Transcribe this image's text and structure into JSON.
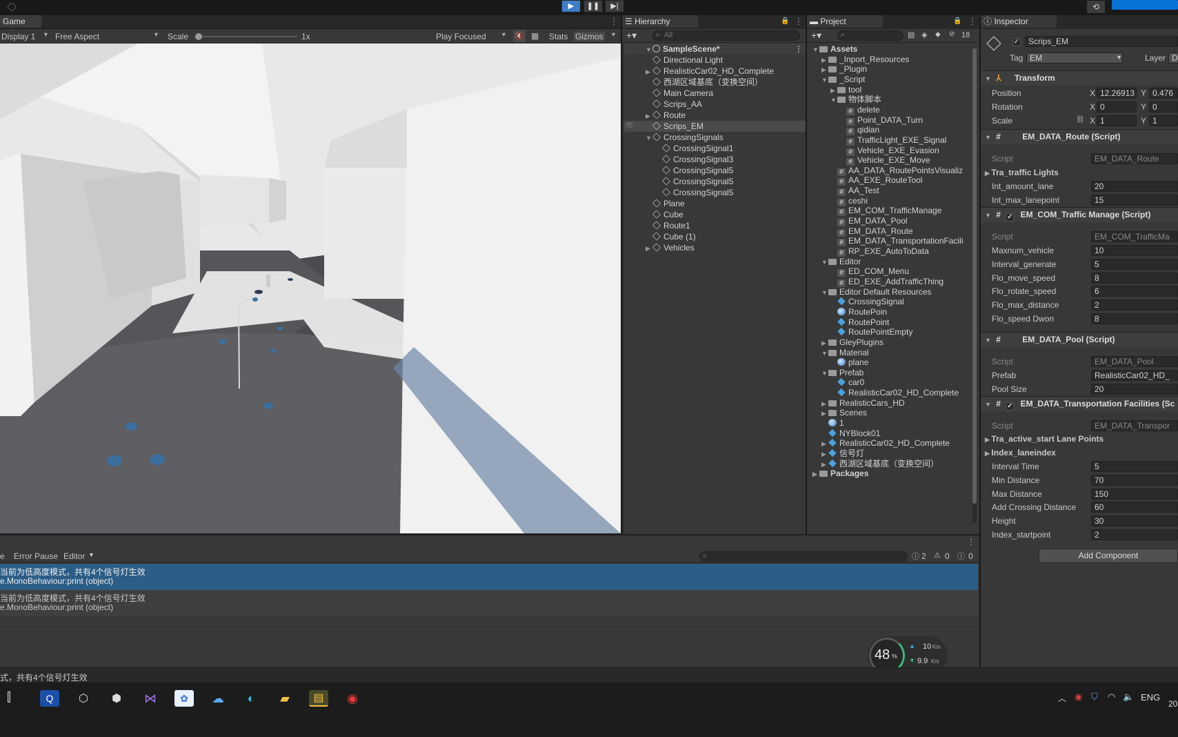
{
  "game": {
    "tab": "Game",
    "display": "Display 1",
    "aspect": "Free Aspect",
    "scale_label": "Scale",
    "scale_value": "1x",
    "play_mode": "Play Focused",
    "stats": "Stats",
    "gizmos": "Gizmos"
  },
  "hierarchy": {
    "tab": "Hierarchy",
    "search_placeholder": "All",
    "scene": "SampleScene*",
    "items": [
      "Directional Light",
      "RealisticCar02_HD_Complete",
      "西湖区域基底（变换空间）",
      "Main Camera",
      "Scrips_AA",
      "Route",
      "Scrips_EM",
      "CrossingSignals",
      "CrossingSignal1",
      "CrossingSignal3",
      "CrossingSignal5",
      "CrossingSignal5",
      "CrossingSignal5",
      "Plane",
      "Cube",
      "Route1",
      "Cube (1)",
      "Vehicles"
    ]
  },
  "project": {
    "tab": "Project",
    "badge": "18",
    "items": [
      "Assets",
      "_Inport_Resources",
      "_Plugin",
      "_Script",
      "tool",
      "物体脚本",
      "delete",
      "Point_DATA_Turn",
      "qidian",
      "TrafficLight_EXE_Signal",
      "Vehicle_EXE_Evasion",
      "Vehicle_EXE_Move",
      "AA_DATA_RoutePointsVisualiz",
      "AA_EXE_RouteTool",
      "AA_Test",
      "ceshi",
      "EM_COM_TrafficManage",
      "EM_DATA_Pool",
      "EM_DATA_Route",
      "EM_DATA_TransportationFacili",
      "RP_EXE_AutoToData",
      "Editor",
      "ED_COM_Menu",
      "ED_EXE_AddTrafficThing",
      "Editor Default Resources",
      "CrossingSignal",
      "RoutePoin",
      "RoutePoint",
      "RoutePointEmpty",
      "GleyPlugins",
      "Material",
      "plane",
      "Prefab",
      "car0",
      "RealisticCar02_HD_Complete",
      "RealisticCars_HD",
      "Scenes",
      "1",
      "NYBlock01",
      "RealisticCar02_HD_Complete",
      "信号灯",
      "西湖区域基底（变换空间）",
      "Packages"
    ]
  },
  "inspector": {
    "tab": "Inspector",
    "object_name": "Scrips_EM",
    "tag_label": "Tag",
    "tag_value": "EM",
    "layer_label": "Layer",
    "layer_value": "Defa",
    "transform": {
      "title": "Transform",
      "position_label": "Position",
      "position_x": "12.26913",
      "position_y": "0.476",
      "rotation_label": "Rotation",
      "rotation_x": "0",
      "rotation_y": "0",
      "scale_label": "Scale",
      "scale_x": "1",
      "scale_y": "1",
      "x": "X",
      "y": "Y"
    },
    "route": {
      "title": "EM_DATA_Route (Script)",
      "script_label": "Script",
      "script_value": "EM_DATA_Route",
      "lights": "Tra_traffic Lights",
      "amount_label": "Int_amount_lane",
      "amount_value": "20",
      "max_label": "Int_max_lanepoint",
      "max_value": "15"
    },
    "traffic": {
      "title": "EM_COM_Traffic Manage (Script)",
      "script_label": "Script",
      "script_value": "EM_COM_TrafficMa",
      "fields": [
        {
          "label": "Maxnum_vehicle",
          "value": "10"
        },
        {
          "label": "Interval_generate",
          "value": "5"
        },
        {
          "label": "Flo_move_speed",
          "value": "8"
        },
        {
          "label": "Flo_rotate_speed",
          "value": "6"
        },
        {
          "label": "Flo_max_distance",
          "value": "2"
        },
        {
          "label": "Flo_speed Dwon",
          "value": "8"
        }
      ]
    },
    "pool": {
      "title": "EM_DATA_Pool (Script)",
      "script_label": "Script",
      "script_value": "EM_DATA_Pool",
      "prefab_label": "Prefab",
      "prefab_value": "RealisticCar02_HD_",
      "size_label": "Pool Size",
      "size_value": "20"
    },
    "facilities": {
      "title": "EM_DATA_Transportation Facilities (Sc",
      "script_label": "Script",
      "script_value": "EM_DATA_Transpor",
      "lane_points": "Tra_active_start Lane Points",
      "lane_index": "Index_laneindex",
      "fields": [
        {
          "label": "Interval Time",
          "value": "5"
        },
        {
          "label": "Min Distance",
          "value": "70"
        },
        {
          "label": "Max Distance",
          "value": "150"
        },
        {
          "label": "Add Crossing Distance",
          "value": "60"
        },
        {
          "label": "Height",
          "value": "30"
        },
        {
          "label": "Index_startpoint",
          "value": "2"
        }
      ]
    },
    "add_component": "Add Component"
  },
  "console": {
    "clear_partial": "e",
    "error_pause": "Error Pause",
    "editor": "Editor",
    "count_info": "2",
    "count_warn": "0",
    "count_error": "0",
    "messages": [
      {
        "line1": "当前为低高度模式，共有4个信号灯生效",
        "line2": "e.MonoBehaviour:print (object)"
      },
      {
        "line1": "当前为低高度模式，共有4个信号灯生效",
        "line2": "e.MonoBehaviour:print (object)"
      }
    ],
    "status": "式，共有4个信号灯生效"
  },
  "net_widget": {
    "percent": "48",
    "unit": "%",
    "up": "10",
    "down": "9.9",
    "rate_unit": "K/s"
  },
  "taskbar": {
    "lang": "ENG",
    "clock_partial": "20"
  },
  "colors": {
    "accent": "#2c5d87",
    "selection": "#2c5d87",
    "play_active": "#3d7fc6"
  }
}
